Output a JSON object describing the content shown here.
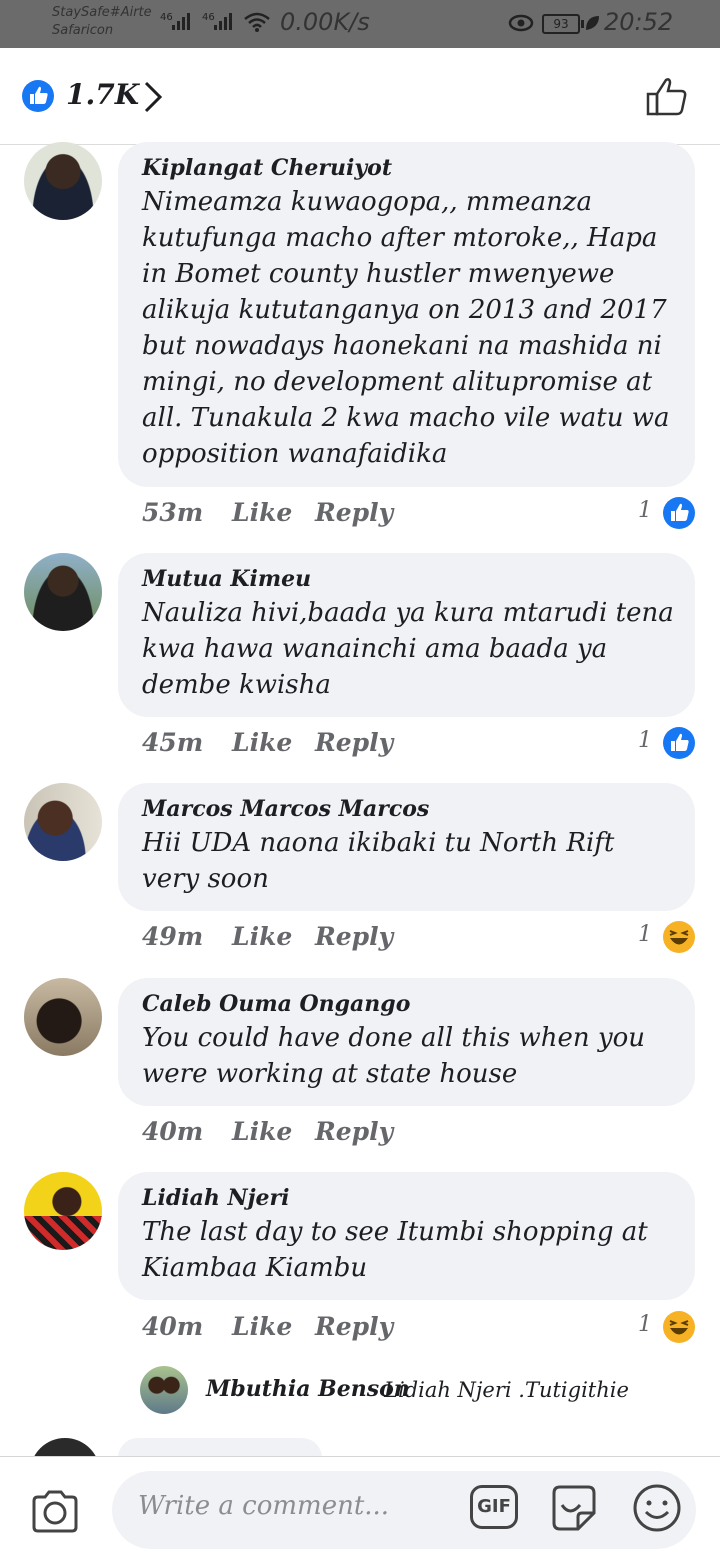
{
  "status_bar": {
    "carrier_line1": "StaySafe#Airte",
    "carrier_line2": "Safaricon",
    "signal1": "46",
    "signal2": "46",
    "net_speed": "0.00K/s",
    "battery": "93",
    "time": "20:52"
  },
  "header": {
    "like_count": "1.7K"
  },
  "comments": [
    {
      "author": "Kiplangat Cheruiyot",
      "text": "Nimeamza kuwaogopa,, mmeanza kutufunga macho after mtoroke,, Hapa in Bomet county hustler mwenyewe alikuja kututanganya on 2013 and 2017 but nowadays haonekani na mashida ni mingi, no development alitupromise at all. Tunakula 2 kwa macho vile watu wa opposition wanafaidika",
      "time": "53m",
      "like_label": "Like",
      "reply_label": "Reply",
      "reaction_count": "1",
      "reaction": "like"
    },
    {
      "author": "Mutua Kimeu",
      "text": "Nauliza hivi,baada ya kura mtarudi tena kwa hawa wanainchi ama baada ya dembe kwisha",
      "time": "45m",
      "like_label": "Like",
      "reply_label": "Reply",
      "reaction_count": "1",
      "reaction": "like"
    },
    {
      "author": "Marcos Marcos Marcos",
      "text": "Hii UDA naona ikibaki tu North Rift very soon",
      "time": "49m",
      "like_label": "Like",
      "reply_label": "Reply",
      "reaction_count": "1",
      "reaction": "haha"
    },
    {
      "author": "Caleb Ouma Ongango",
      "text": "You could have done all this when you were working at state house",
      "time": "40m",
      "like_label": "Like",
      "reply_label": "Reply",
      "reaction_count": "",
      "reaction": ""
    },
    {
      "author": "Lidiah Njeri",
      "text": "The last day to see Itumbi shopping at Kiambaa Kiambu",
      "time": "40m",
      "like_label": "Like",
      "reply_label": "Reply",
      "reaction_count": "1",
      "reaction": "haha"
    }
  ],
  "reply_preview": {
    "author": "Mbuthia Benson",
    "text": "Lidiah Njeri .Tutigithie"
  },
  "composer": {
    "placeholder": "Write a comment...",
    "gif_label": "GIF"
  },
  "colors": {
    "accent": "#1877f2",
    "bubble": "#f0f2f5",
    "haha": "#f7b125"
  }
}
